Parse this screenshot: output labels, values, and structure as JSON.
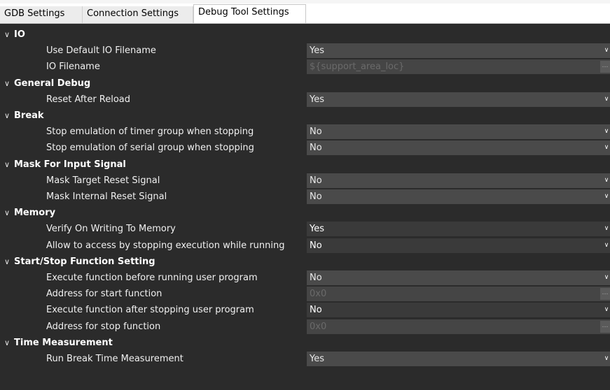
{
  "tabs": [
    {
      "label": "GDB Settings",
      "active": false
    },
    {
      "label": "Connection Settings",
      "active": false
    },
    {
      "label": "Debug Tool Settings",
      "active": true
    }
  ],
  "categories": [
    {
      "title": "IO",
      "props": [
        {
          "label": "Use Default IO Filename",
          "value": "Yes",
          "control": "dropdown",
          "state": "normal"
        },
        {
          "label": "IO Filename",
          "value": "${support_area_loc}",
          "control": "browse",
          "state": "disabled"
        }
      ]
    },
    {
      "title": "General Debug",
      "props": [
        {
          "label": "Reset After Reload",
          "value": "Yes",
          "control": "dropdown",
          "state": "normal"
        }
      ]
    },
    {
      "title": "Break",
      "props": [
        {
          "label": "Stop emulation of timer group when stopping",
          "value": "No",
          "control": "dropdown",
          "state": "normal"
        },
        {
          "label": "Stop emulation of serial group when stopping",
          "value": "No",
          "control": "dropdown",
          "state": "normal"
        }
      ]
    },
    {
      "title": "Mask For Input Signal",
      "props": [
        {
          "label": "Mask Target Reset Signal",
          "value": "No",
          "control": "dropdown",
          "state": "normal"
        },
        {
          "label": "Mask Internal Reset Signal",
          "value": "No",
          "control": "dropdown",
          "state": "normal"
        }
      ]
    },
    {
      "title": "Memory",
      "props": [
        {
          "label": "Verify On Writing To Memory",
          "value": "Yes",
          "control": "dropdown",
          "state": "dark"
        },
        {
          "label": "Allow to access by stopping execution while running",
          "value": "No",
          "control": "dropdown",
          "state": "dark"
        }
      ]
    },
    {
      "title": "Start/Stop Function Setting",
      "props": [
        {
          "label": "Execute function before running user program",
          "value": "No",
          "control": "dropdown",
          "state": "normal"
        },
        {
          "label": "Address for start function",
          "value": "0x0",
          "control": "browse",
          "state": "disabled"
        },
        {
          "label": "Execute function after stopping user program",
          "value": "No",
          "control": "dropdown",
          "state": "dark"
        },
        {
          "label": "Address for stop function",
          "value": "0x0",
          "control": "browse",
          "state": "disabled"
        }
      ]
    },
    {
      "title": "Time Measurement",
      "props": [
        {
          "label": "Run Break Time Measurement",
          "value": "Yes",
          "control": "dropdown",
          "state": "normal"
        }
      ]
    }
  ],
  "icons": {
    "expanded": "chevron-down-icon",
    "dropdown": "dropdown-arrow-icon",
    "browse": "ellipsis-icon"
  }
}
